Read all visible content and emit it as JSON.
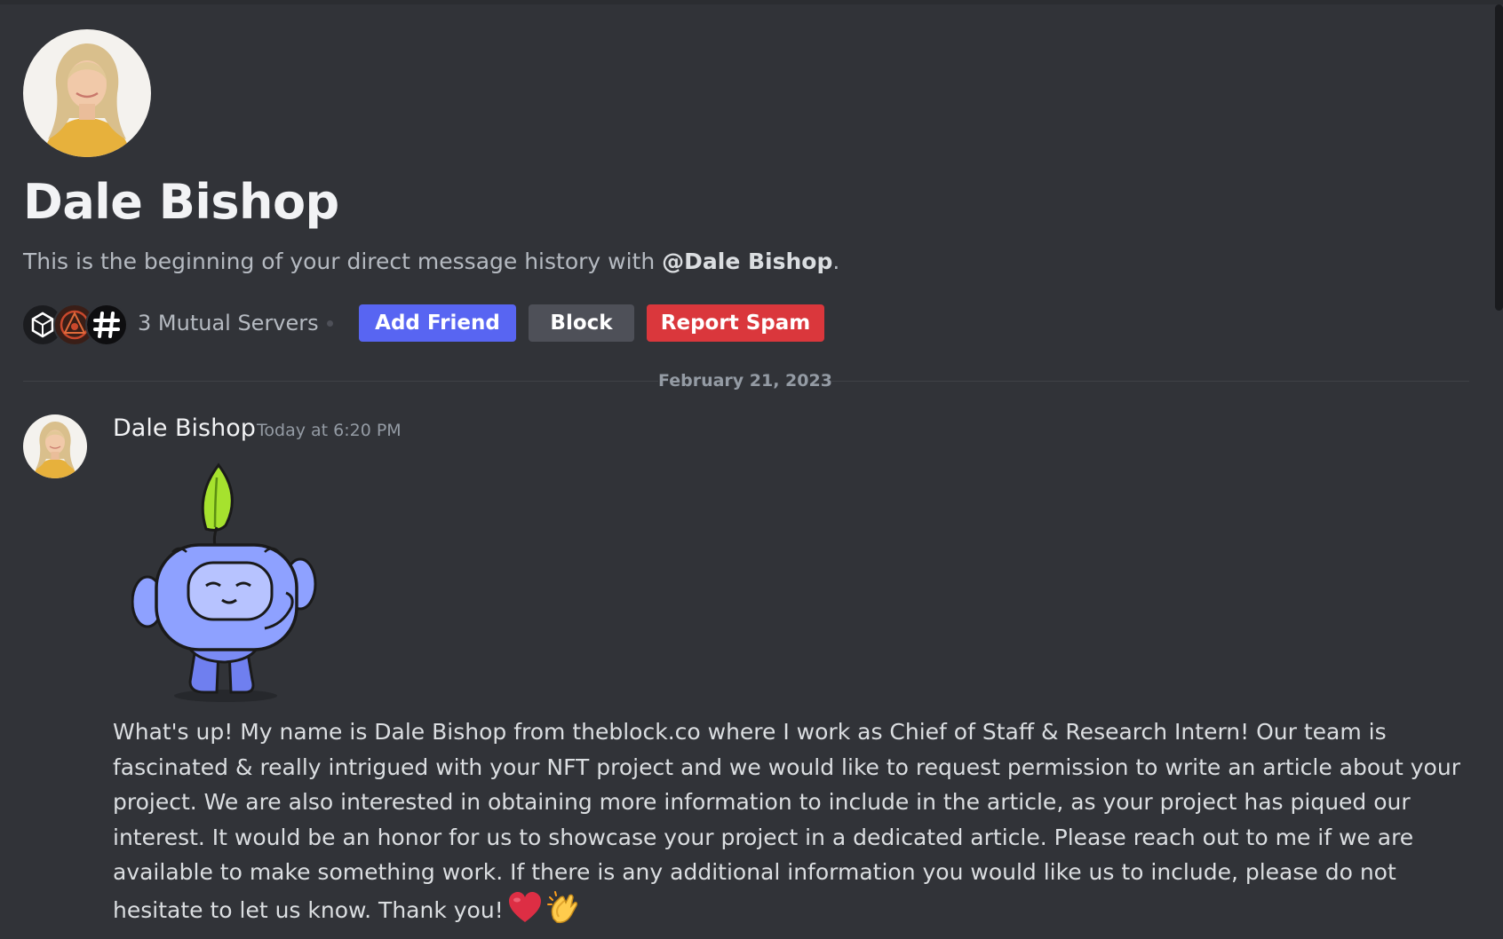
{
  "profile": {
    "display_name": "Dale Bishop",
    "intro_prefix": "This is the beginning of your direct message history with ",
    "mention": "@Dale Bishop",
    "intro_suffix": "."
  },
  "mutual_servers": {
    "label": "3 Mutual Servers",
    "icons": [
      "cube-server-icon",
      "emblem-server-icon",
      "hashtag-server-icon"
    ]
  },
  "actions": {
    "add_friend": "Add Friend",
    "block": "Block",
    "report_spam": "Report Spam"
  },
  "divider": {
    "date": "February 21, 2023"
  },
  "message": {
    "author": "Dale Bishop",
    "timestamp": "Today at 6:20 PM",
    "sticker": "wumpus-leaf-wave-sticker",
    "text": "What's up! My name is Dale Bishop from theblock.co where I work as Chief of Staff & Research Intern! Our team is fascinated & really intrigued with your NFT project and we would like to request permission to write an article about your project. We are also interested in obtaining more information to include in the article, as your project has piqued our interest. It would be an honor for us to showcase your project in a dedicated article. Please reach out to me if we are available to make something work. If there is any additional information you would like us to include, please do not hesitate to let us know. Thank you!",
    "emojis": [
      "red-heart-emoji",
      "clapping-hands-emoji"
    ]
  },
  "colors": {
    "background": "#313338",
    "brand_blurple": "#5865f2",
    "secondary_button": "#4e5058",
    "danger_button": "#da373c",
    "muted_text": "#949ba4"
  }
}
